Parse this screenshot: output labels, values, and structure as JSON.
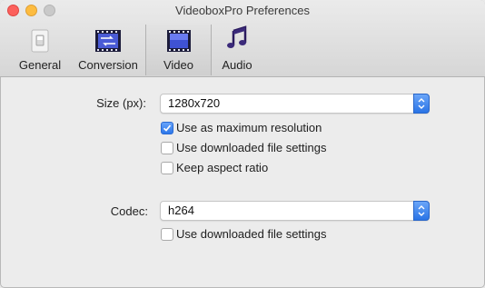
{
  "window": {
    "title": "VideoboxPro Preferences"
  },
  "toolbar": {
    "tabs": [
      {
        "label": "General",
        "icon": "switch-icon"
      },
      {
        "label": "Conversion",
        "icon": "film-convert-icon"
      },
      {
        "label": "Video",
        "icon": "film-icon",
        "selected": true
      },
      {
        "label": "Audio",
        "icon": "music-note-icon"
      }
    ]
  },
  "video_settings": {
    "size_label": "Size (px):",
    "size_value": "1280x720",
    "size_options": {
      "max_resolution": {
        "label": "Use as maximum resolution",
        "checked": true
      },
      "downloaded_settings": {
        "label": "Use downloaded file settings",
        "checked": false
      },
      "keep_aspect": {
        "label": "Keep aspect ratio",
        "checked": false
      }
    },
    "codec_label": "Codec:",
    "codec_value": "h264",
    "codec_options": {
      "downloaded_settings": {
        "label": "Use downloaded file settings",
        "checked": false
      }
    }
  },
  "colors": {
    "accent": "#2d77ea",
    "close": "#fc605c",
    "minimize": "#fdbc40",
    "zoom_disabled": "#c9c9c9"
  }
}
